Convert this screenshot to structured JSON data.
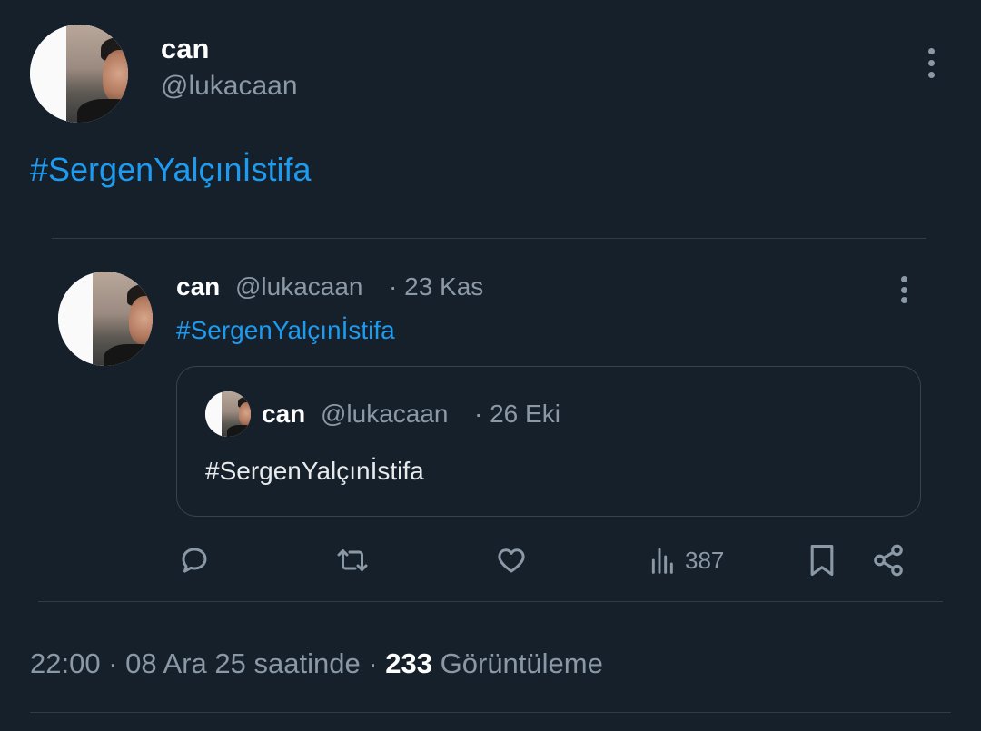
{
  "tweet": {
    "author": {
      "name": "can",
      "handle": "@lukacaan"
    },
    "text": "#SergenYalçınİstifa",
    "meta": {
      "time": "22:00",
      "separator": "·",
      "date_suffix": "08 Ara 25 saatinde",
      "views_count": "233",
      "views_label": "Görüntüleme"
    }
  },
  "quoted_tweet": {
    "author": {
      "name": "can",
      "handle": "@lukacaan"
    },
    "date": "· 23 Kas",
    "text": "#SergenYalçınİstifa",
    "nested_quote": {
      "author": {
        "name": "can",
        "handle": "@lukacaan"
      },
      "date": "· 26 Eki",
      "text": "#SergenYalçınİstifa"
    },
    "actions": {
      "views": "387"
    }
  },
  "colors": {
    "background": "#15202b",
    "accent": "#1d9bf0",
    "muted": "#8b98a5",
    "text": "#e7e9ea"
  },
  "icons": [
    "more-icon",
    "reply-icon",
    "retweet-icon",
    "like-icon",
    "views-icon",
    "bookmark-icon",
    "share-icon"
  ]
}
